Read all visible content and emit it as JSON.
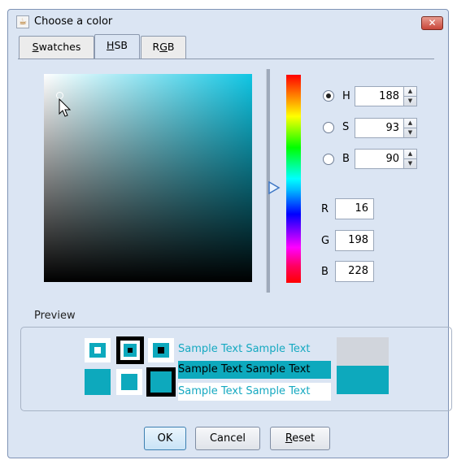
{
  "window": {
    "title": "Choose a color",
    "close_glyph": "✕",
    "app_icon": "java-cup-icon"
  },
  "tabs": [
    {
      "label": "Swatches",
      "mnemonic_char": "S",
      "rest": "watches",
      "active": false
    },
    {
      "label": "HSB",
      "mnemonic_char": "H",
      "rest": "SB",
      "active": true
    },
    {
      "label": "RGB",
      "pre": "R",
      "mnemonic_char": "G",
      "rest": "B",
      "active": false
    }
  ],
  "hsb": {
    "h_label": "H",
    "h_value": "188",
    "s_label": "S",
    "s_value": "93",
    "b_label": "B",
    "b_value": "90",
    "selected_mode": "H"
  },
  "rgb": {
    "r_label": "R",
    "r_value": "16",
    "g_label": "G",
    "g_value": "198",
    "b_label": "B",
    "b_value": "228"
  },
  "colors": {
    "selected": "#10c6e4",
    "preview": "#0da9bd",
    "old_color": "#d1d5dc"
  },
  "preview": {
    "label": "Preview",
    "sample_text": "Sample Text"
  },
  "buttons": {
    "ok": "OK",
    "cancel": "Cancel",
    "reset_mnemonic": "R",
    "reset_rest": "eset"
  }
}
